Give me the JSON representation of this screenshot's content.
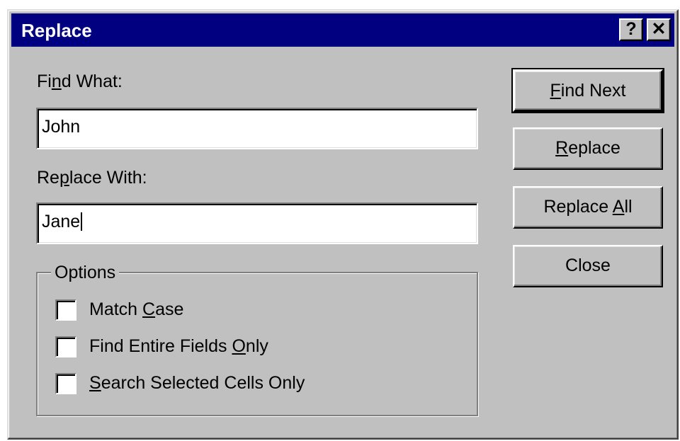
{
  "window": {
    "title": "Replace",
    "help_button": "?",
    "close_button": "✕"
  },
  "find": {
    "label_pre": "Fi",
    "label_key": "n",
    "label_post": "d What:",
    "value": "John"
  },
  "replace_with": {
    "label_pre": "Re",
    "label_key": "p",
    "label_post": "lace With:",
    "value": "Jane"
  },
  "options": {
    "legend": "Options",
    "match_case": {
      "pre": "Match ",
      "key": "C",
      "post": "ase",
      "checked": false
    },
    "entire_fields": {
      "pre": "Find Entire Fields ",
      "key": "O",
      "post": "nly",
      "checked": false
    },
    "selected_cells": {
      "pre": "",
      "key": "S",
      "post": "earch Selected Cells Only",
      "checked": false
    }
  },
  "buttons": {
    "find_next": {
      "pre": "",
      "key": "F",
      "post": "ind Next"
    },
    "replace": {
      "pre": "",
      "key": "R",
      "post": "eplace"
    },
    "replace_all": {
      "pre": "Replace ",
      "key": "A",
      "post": "ll"
    },
    "close": {
      "pre": "Close",
      "key": "",
      "post": ""
    }
  },
  "colors": {
    "titlebar": "#000080",
    "face": "#c0c0c0"
  }
}
